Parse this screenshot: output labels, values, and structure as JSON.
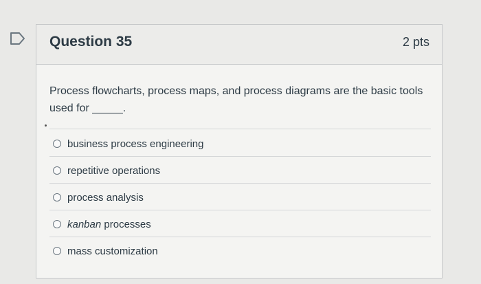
{
  "question": {
    "title": "Question 35",
    "points": "2 pts",
    "text": "Process flowcharts, process maps, and process diagrams are the basic tools used for _____."
  },
  "answers": [
    {
      "label": "business process engineering",
      "selected": false
    },
    {
      "label": "repetitive operations",
      "selected": false
    },
    {
      "label": "process analysis",
      "selected": false
    },
    {
      "label_italic": "kanban",
      "label_rest": " processes",
      "selected": false
    },
    {
      "label": "mass customization",
      "selected": false
    }
  ],
  "icons": {
    "flag": "flag-icon",
    "radio": "radio-button-icon"
  }
}
